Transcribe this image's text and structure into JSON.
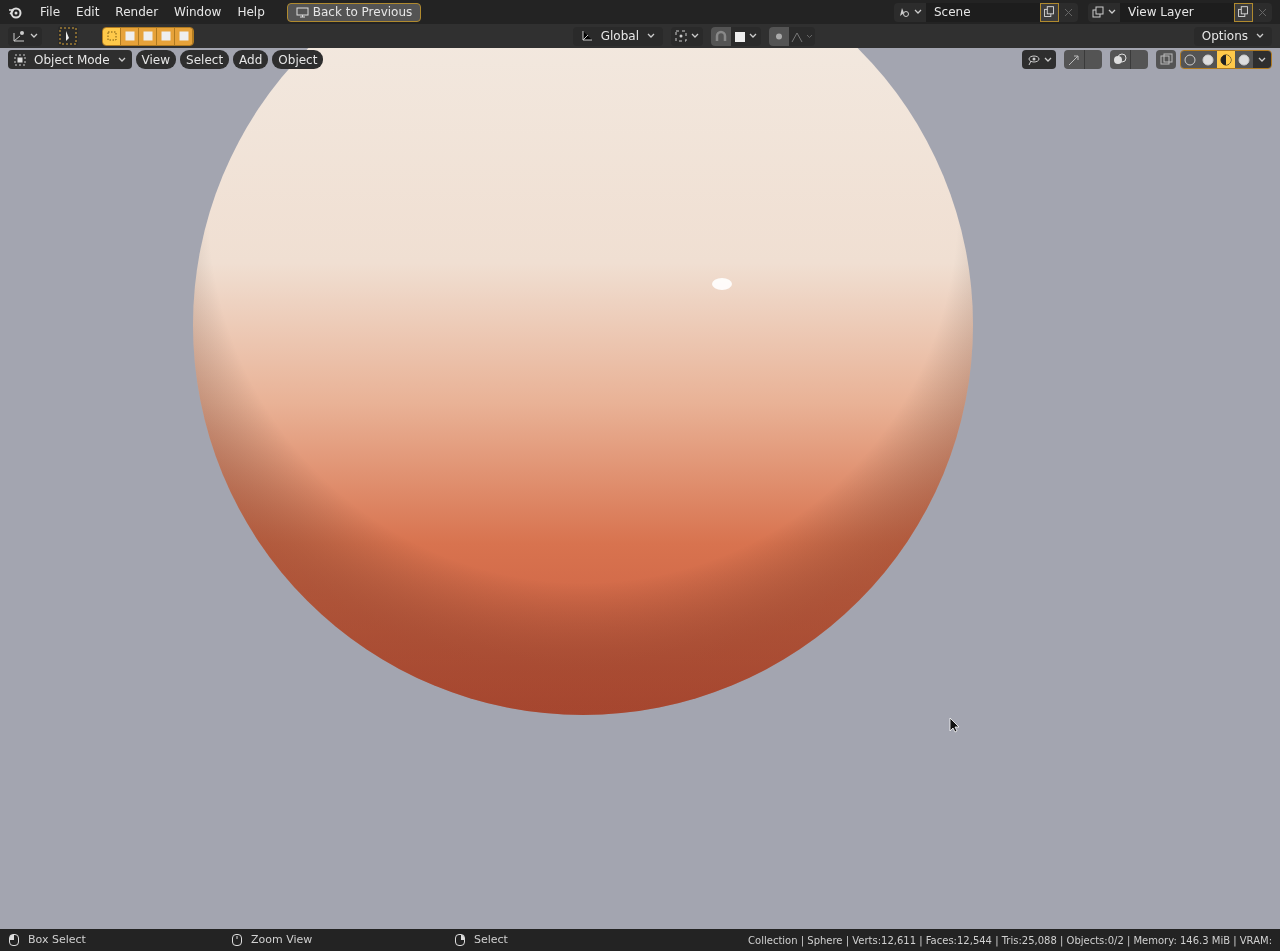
{
  "menu": [
    "File",
    "Edit",
    "Render",
    "Window",
    "Help"
  ],
  "back_button": "Back to Previous",
  "scene": {
    "name": "Scene"
  },
  "view_layer": {
    "name": "View Layer"
  },
  "select_modes": [
    {
      "selected": true
    },
    {
      "selected": false
    },
    {
      "selected": false
    },
    {
      "selected": false
    },
    {
      "selected": false
    }
  ],
  "orientation": "Global",
  "options": "Options",
  "viewport_header": {
    "mode": "Object Mode",
    "menus": [
      "View",
      "Select",
      "Add",
      "Object"
    ]
  },
  "shading_modes": [
    {
      "selected": false
    },
    {
      "selected": false
    },
    {
      "selected": true
    },
    {
      "selected": false
    }
  ],
  "status_bar": {
    "hints": [
      {
        "kind": "left",
        "label": "Box Select"
      },
      {
        "kind": "middle",
        "label": "Zoom View"
      },
      {
        "kind": "right",
        "label": "Select"
      }
    ],
    "stats": "Collection | Sphere | Verts:12,611 | Faces:12,544 | Tris:25,088 | Objects:0/2 | Memory: 146.3 MiB | VRAM:"
  }
}
